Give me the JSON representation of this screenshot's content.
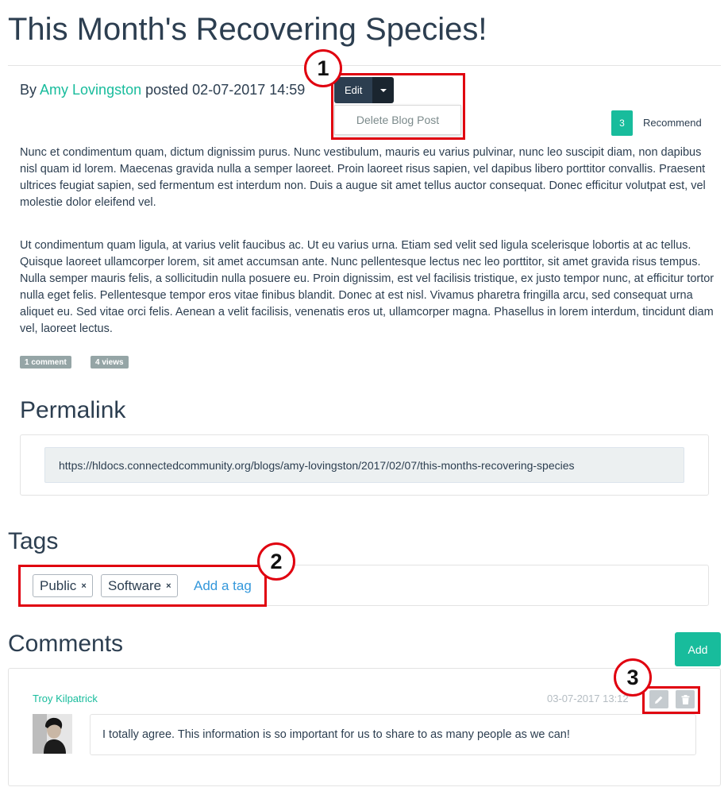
{
  "post": {
    "title": "This Month's Recovering Species!",
    "byline_prefix": "By",
    "author": "Amy Lovingston",
    "posted_text": "posted 02-07-2017 14:59",
    "edit_label": "Edit",
    "dropdown_item": "Delete Blog Post",
    "recommend_count": "3",
    "recommend_label": "Recommend",
    "paragraphs": [
      "Nunc et condimentum quam, dictum dignissim purus. Nunc vestibulum, mauris eu varius pulvinar, nunc leo suscipit diam, non dapibus nisl quam id lorem. Maecenas gravida nulla a semper laoreet. Proin laoreet risus sapien, vel dapibus libero porttitor convallis. Praesent ultrices feugiat sapien, sed fermentum est interdum non. Duis a augue sit amet tellus auctor consequat. Donec efficitur volutpat est, vel molestie dolor eleifend vel.",
      "Ut condimentum quam ligula, at varius velit faucibus ac. Ut eu varius urna. Etiam sed velit sed ligula scelerisque lobortis at ac tellus. Quisque laoreet ullamcorper lorem, sit amet accumsan ante. Nunc pellentesque lectus nec leo porttitor, sit amet gravida risus tempus. Nulla semper mauris felis, a sollicitudin nulla posuere eu. Proin dignissim, est vel facilisis tristique, ex justo tempor nunc, at efficitur tortor nulla eget felis. Pellentesque tempor eros vitae finibus blandit. Donec at est nisl. Vivamus pharetra fringilla arcu, sed consequat urna aliquet eu. Sed vitae orci felis. Aenean a velit facilisis, venenatis eros ut, ullamcorper magna. Phasellus in lorem interdum, tincidunt diam vel, laoreet lectus."
    ],
    "comments_badge": "1 comment",
    "views_badge": "4 views"
  },
  "permalink": {
    "heading": "Permalink",
    "url": "https://hldocs.connectedcommunity.org/blogs/amy-lovingston/2017/02/07/this-months-recovering-species"
  },
  "tags": {
    "heading": "Tags",
    "items": [
      {
        "label": "Public",
        "remove": "×"
      },
      {
        "label": "Software",
        "remove": "×"
      }
    ],
    "add_label": "Add a tag"
  },
  "comments": {
    "heading": "Comments",
    "add_label": "Add",
    "items": [
      {
        "author": "Troy Kilpatrick",
        "timestamp": "03-07-2017 13:12",
        "text": "I totally agree. This information is so important for us to share to as many people as we can!"
      }
    ]
  },
  "annotations": {
    "markers": [
      "1",
      "2",
      "3"
    ],
    "color": "#e0000f"
  },
  "colors": {
    "primary": "#2c3e50",
    "accent": "#18bc9c",
    "link": "#3498db"
  },
  "icons": [
    "caret-down-icon",
    "close-icon",
    "pencil-icon",
    "trash-icon"
  ]
}
